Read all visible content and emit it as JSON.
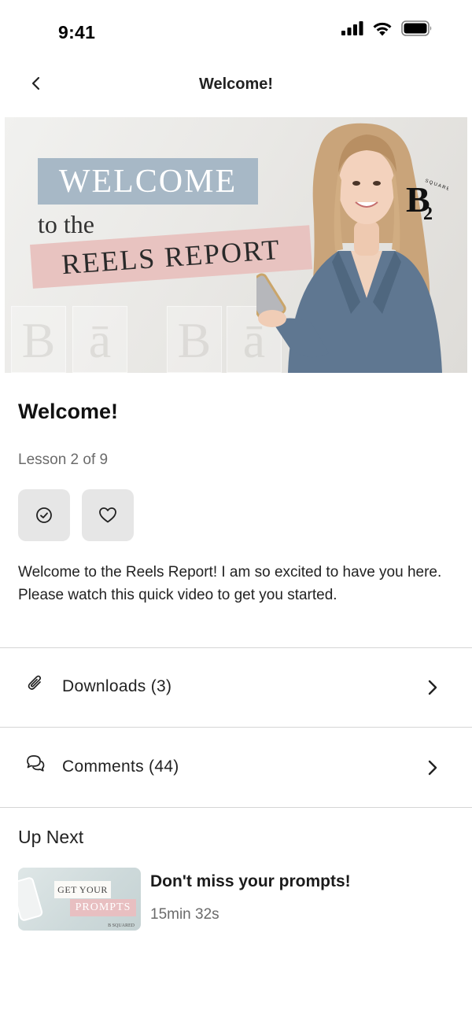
{
  "status": {
    "time": "9:41",
    "icons": [
      "cellular-signal-icon",
      "wifi-icon",
      "battery-icon"
    ]
  },
  "nav": {
    "title": "Welcome!",
    "back_icon": "chevron-left-icon"
  },
  "hero": {
    "welcome": "WELCOME",
    "to_the": "to the",
    "reels_report": "REELS REPORT",
    "logo_text": "B2",
    "logo_ring_text": "B SQUARED SOCIAL"
  },
  "lesson": {
    "title": "Welcome!",
    "subtitle": "Lesson 2 of 9",
    "actions": [
      {
        "name": "complete-button",
        "icon": "check-circle-icon"
      },
      {
        "name": "favorite-button",
        "icon": "heart-icon"
      }
    ],
    "description_line1": "Welcome to the Reels Report! I am so excited to have you here.",
    "description_line2": "Please watch this quick video to get you started."
  },
  "rows": {
    "downloads": {
      "label": "Downloads (3)",
      "icon": "paperclip-icon"
    },
    "comments": {
      "label": "Comments (44)",
      "icon": "chat-bubbles-icon"
    }
  },
  "up_next": {
    "heading": "Up Next",
    "item": {
      "title": "Don't miss your prompts!",
      "duration": "15min 32s",
      "thumb_line1": "GET YOUR",
      "thumb_line2": "PROMPTS",
      "thumb_brand": "B SQUARED"
    }
  },
  "colors": {
    "welcome_box": "#a7b8c6",
    "reels_box": "#e8c3c0",
    "action_button_bg": "#e6e6e6",
    "divider": "#d5d5d5",
    "secondary_text": "#6b6b6b"
  }
}
